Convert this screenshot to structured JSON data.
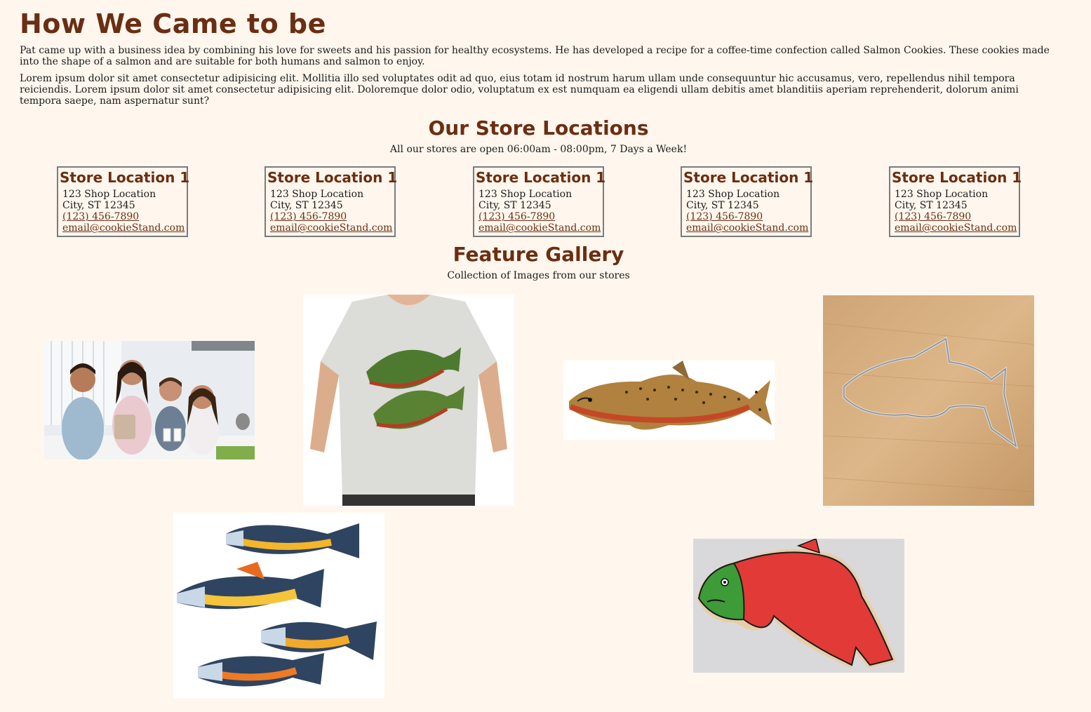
{
  "about": {
    "title": "How We Came to be",
    "paragraph1": "Pat came up with a business idea by combining his love for sweets and his passion for healthy ecosystems. He has developed a recipe for a coffee-time confection called Salmon Cookies. These cookies made into the shape of a salmon and are suitable for both humans and salmon to enjoy.",
    "paragraph2": "Lorem ipsum dolor sit amet consectetur adipisicing elit. Mollitia illo sed voluptates odit ad quo, eius totam id nostrum harum ullam unde consequuntur hic accusamus, vero, repellendus nihil tempora reiciendis. Lorem ipsum dolor sit amet consectetur adipisicing elit. Doloremque dolor odio, voluptatum ex est numquam ea eligendi ullam debitis amet blanditiis aperiam reprehenderit, dolorum animi tempora saepe, nam aspernatur sunt?"
  },
  "locations": {
    "title": "Our Store Locations",
    "hours": "All our stores are open 06:00am - 08:00pm, 7 Days a Week!",
    "stores": [
      {
        "name": "Store Location 1",
        "street": "123 Shop Location",
        "city": "City, ST 12345",
        "phone": "(123) 456-7890",
        "email": "email@cookieStand.com"
      },
      {
        "name": "Store Location 1",
        "street": "123 Shop Location",
        "city": "City, ST 12345",
        "phone": "(123) 456-7890",
        "email": "email@cookieStand.com"
      },
      {
        "name": "Store Location 1",
        "street": "123 Shop Location",
        "city": "City, ST 12345",
        "phone": "(123) 456-7890",
        "email": "email@cookieStand.com"
      },
      {
        "name": "Store Location 1",
        "street": "123 Shop Location",
        "city": "City, ST 12345",
        "phone": "(123) 456-7890",
        "email": "email@cookieStand.com"
      },
      {
        "name": "Store Location 1",
        "street": "123 Shop Location",
        "city": "City, ST 12345",
        "phone": "(123) 456-7890",
        "email": "email@cookieStand.com"
      }
    ]
  },
  "gallery": {
    "title": "Feature Gallery",
    "subtitle": "Collection of Images from our stores",
    "images": [
      {
        "name": "family-photo"
      },
      {
        "name": "salmon-tshirt-photo"
      },
      {
        "name": "salmon-illustration"
      },
      {
        "name": "cookie-cutter-photo"
      },
      {
        "name": "decorated-salmon-cookies-photo"
      },
      {
        "name": "red-salmon-cookie-photo"
      }
    ]
  },
  "colors": {
    "background": "#fff7ee",
    "heading": "#6b2e12",
    "border": "#7b7b7b"
  }
}
